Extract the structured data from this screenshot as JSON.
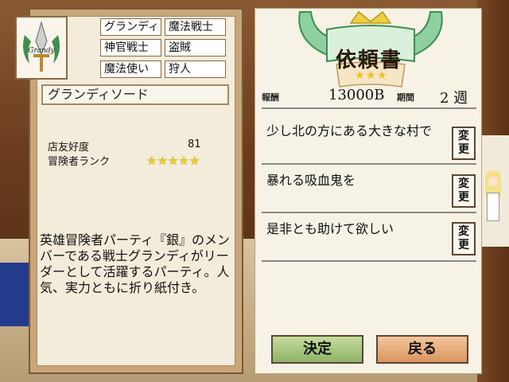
{
  "adventurer": {
    "crest_text": "Grandy",
    "classes": [
      "グランディ",
      "魔法戦士",
      "神官戦士",
      "盗賊",
      "魔法使い",
      "狩人"
    ],
    "sword_name": "グランディソード",
    "stats": {
      "favor_label": "店友好度",
      "favor_value": "81",
      "rank_label": "冒険者ランク",
      "rank_stars": 5
    },
    "description": "英雄冒険者パーティ『銀』のメンバーである戦士グランディがリーダーとして活躍するパーティ。人気、実力ともに折り紙付き。"
  },
  "request": {
    "title": "依頼書",
    "reward_label": "報酬",
    "reward_value": "13000B",
    "period_label": "期間",
    "period_value": "2 週",
    "lines": [
      {
        "text": "少し北の方にある大きな村で",
        "button": "変更"
      },
      {
        "text": "暴れる吸血鬼を",
        "button": "変更"
      },
      {
        "text": "是非とも助けて欲しい",
        "button": "変更"
      }
    ],
    "ok_label": "決定",
    "back_label": "戻る"
  },
  "colors": {
    "panel_bg": "#f4ecdb",
    "wing_green": "#8fd0a0",
    "crown_gold": "#f0d040",
    "ok_button": "#a8c880",
    "back_button": "#e8ac78"
  }
}
